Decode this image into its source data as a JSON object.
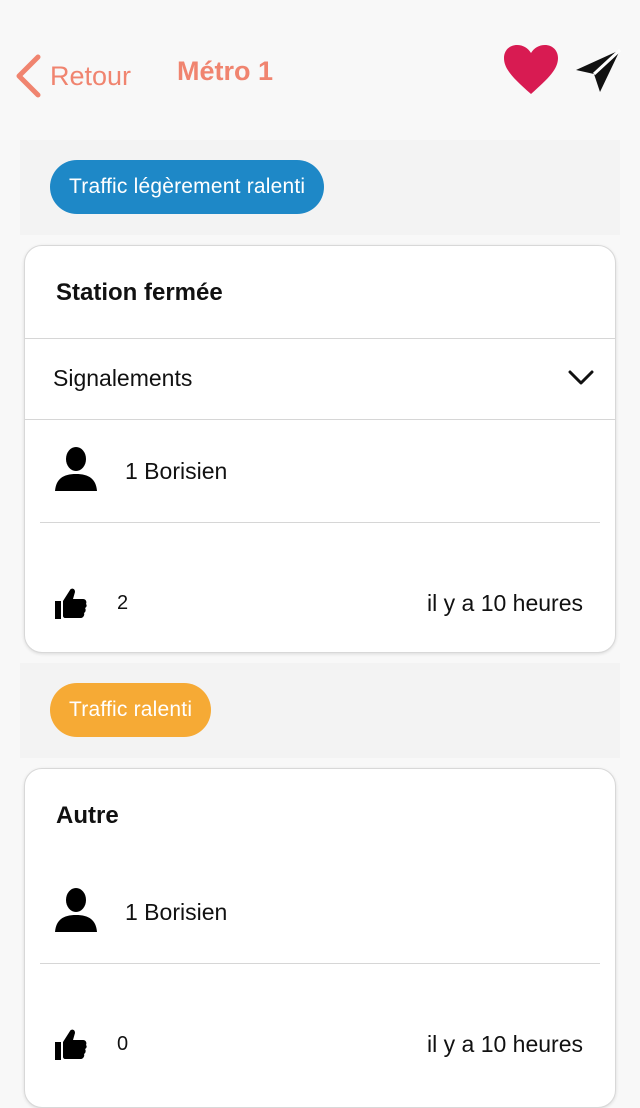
{
  "header": {
    "back_label": "Retour",
    "title": "Métro 1"
  },
  "icons": {
    "back": "chevron-left-icon",
    "favorite": "heart-icon",
    "share": "send-icon",
    "user": "user-icon",
    "like": "thumbs-up-icon",
    "expand": "chevron-down-icon"
  },
  "colors": {
    "accent": "#f0846f",
    "heart": "#d81b52",
    "pill_blue": "#1e88c7",
    "pill_orange": "#f6aa35"
  },
  "sections": [
    {
      "status": "Traffic légèrement ralenti",
      "card": {
        "title": "Station fermée",
        "accordion_label": "Signalements",
        "user_label": "1 Borisien",
        "likes": "2",
        "time": "il y a 10 heures"
      }
    },
    {
      "status": "Traffic ralenti",
      "card": {
        "title": "Autre",
        "user_label": "1 Borisien",
        "likes": "0",
        "time": "il y a 10 heures"
      }
    }
  ]
}
